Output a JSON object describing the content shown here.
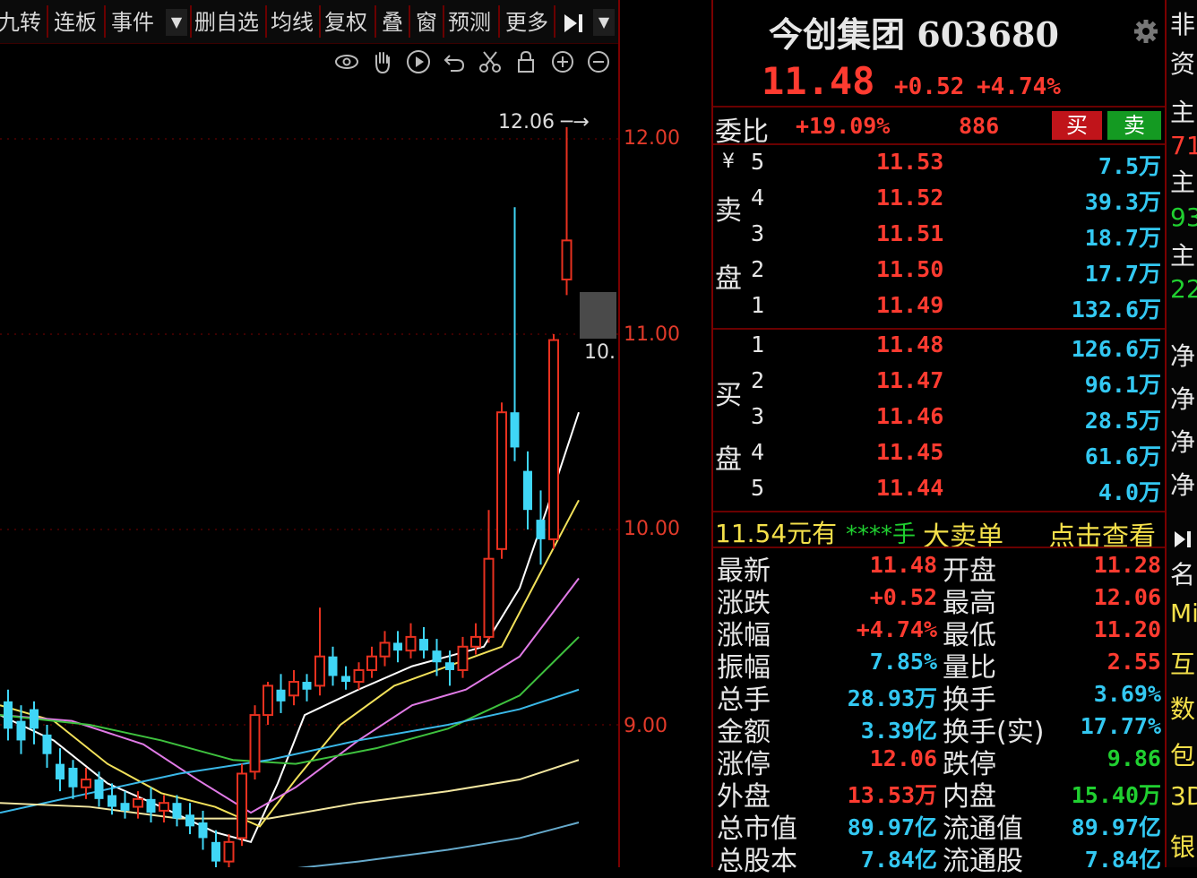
{
  "toolbar": {
    "items": [
      "九转",
      "连板",
      "事件",
      "删自选",
      "均线",
      "复权",
      "叠",
      "窗",
      "预测",
      "更多"
    ],
    "next_icon": "skip-forward-icon",
    "dropdown_icon": "chevron-down-icon"
  },
  "chart_tools": [
    "eye-icon",
    "hand-icon",
    "play-icon",
    "undo-icon",
    "scissors-icon",
    "lock-icon",
    "zoom-in-icon",
    "zoom-out-icon"
  ],
  "chart": {
    "high_marker": "12.06",
    "cursor_label": "10.",
    "y_ticks": [
      "12.00",
      "11.00",
      "10.00",
      "9.00"
    ],
    "colors": {
      "up": "#e8311f",
      "down": "#3fd6f6",
      "axis": "#e13a2a"
    }
  },
  "stock": {
    "name": "今创集团",
    "code": "603680",
    "price": "11.48",
    "change": "+0.52",
    "change_pct": "+4.74%"
  },
  "weibi": {
    "label": "委比",
    "pct": "+19.09%",
    "diff": "886",
    "buy_label": "买",
    "sell_label": "卖"
  },
  "sell_side": {
    "currency": "¥",
    "label_top": "卖",
    "label_bottom": "盘",
    "levels": [
      {
        "n": "5",
        "price": "11.53",
        "vol": "7.5万"
      },
      {
        "n": "4",
        "price": "11.52",
        "vol": "39.3万"
      },
      {
        "n": "3",
        "price": "11.51",
        "vol": "18.7万"
      },
      {
        "n": "2",
        "price": "11.50",
        "vol": "17.7万"
      },
      {
        "n": "1",
        "price": "11.49",
        "vol": "132.6万"
      }
    ]
  },
  "buy_side": {
    "label_top": "买",
    "label_bottom": "盘",
    "levels": [
      {
        "n": "1",
        "price": "11.48",
        "vol": "126.6万"
      },
      {
        "n": "2",
        "price": "11.47",
        "vol": "96.1万"
      },
      {
        "n": "3",
        "price": "11.46",
        "vol": "28.5万"
      },
      {
        "n": "4",
        "price": "11.45",
        "vol": "61.6万"
      },
      {
        "n": "5",
        "price": "11.44",
        "vol": "4.0万"
      }
    ]
  },
  "big_order": {
    "price": "11.54元有",
    "hands": "****手",
    "type": "大卖单",
    "link": "点击查看"
  },
  "stats": [
    {
      "l1": "最新",
      "v1": "11.48",
      "c1": "red",
      "l2": "开盘",
      "v2": "11.28",
      "c2": "red"
    },
    {
      "l1": "涨跌",
      "v1": "+0.52",
      "c1": "red",
      "l2": "最高",
      "v2": "12.06",
      "c2": "red"
    },
    {
      "l1": "涨幅",
      "v1": "+4.74%",
      "c1": "red",
      "l2": "最低",
      "v2": "11.20",
      "c2": "red"
    },
    {
      "l1": "振幅",
      "v1": "7.85%",
      "c1": "cyan",
      "l2": "量比",
      "v2": "2.55",
      "c2": "red"
    },
    {
      "l1": "总手",
      "v1": "28.93万",
      "c1": "cyan",
      "l2": "换手",
      "v2": "3.69%",
      "c2": "cyan"
    },
    {
      "l1": "金额",
      "v1": "3.39亿",
      "c1": "cyan",
      "l2": "换手(实)",
      "v2": "17.77%",
      "c2": "cyan"
    },
    {
      "l1": "涨停",
      "v1": "12.06",
      "c1": "red",
      "l2": "跌停",
      "v2": "9.86",
      "c2": "green"
    },
    {
      "l1": "外盘",
      "v1": "13.53万",
      "c1": "red",
      "l2": "内盘",
      "v2": "15.40万",
      "c2": "green"
    },
    {
      "l1": "总市值",
      "v1": "89.97亿",
      "c1": "cyan",
      "l2": "流通值",
      "v2": "89.97亿",
      "c2": "cyan"
    },
    {
      "l1": "总股本",
      "v1": "7.84亿",
      "c1": "cyan",
      "l2": "流通股",
      "v2": "7.84亿",
      "c2": "cyan"
    }
  ],
  "far_column": {
    "items": [
      {
        "t": "非",
        "c": "white"
      },
      {
        "t": "资",
        "c": "white"
      },
      {
        "t": "主",
        "c": "white"
      },
      {
        "t": "71",
        "c": "red"
      },
      {
        "t": "主",
        "c": "white"
      },
      {
        "t": "93",
        "c": "green"
      },
      {
        "t": "主",
        "c": "white"
      },
      {
        "t": "22",
        "c": "green"
      },
      {
        "t": "净",
        "c": "white"
      },
      {
        "t": "净",
        "c": "white"
      },
      {
        "t": "净",
        "c": "white"
      },
      {
        "t": "净",
        "c": "white"
      },
      {
        "t": "名",
        "c": "white"
      },
      {
        "t": "Mi",
        "c": "yellow"
      },
      {
        "t": "互",
        "c": "yellow"
      },
      {
        "t": "数",
        "c": "yellow"
      },
      {
        "t": "包",
        "c": "yellow"
      },
      {
        "t": "3D",
        "c": "yellow"
      },
      {
        "t": "银",
        "c": "yellow"
      }
    ]
  }
}
